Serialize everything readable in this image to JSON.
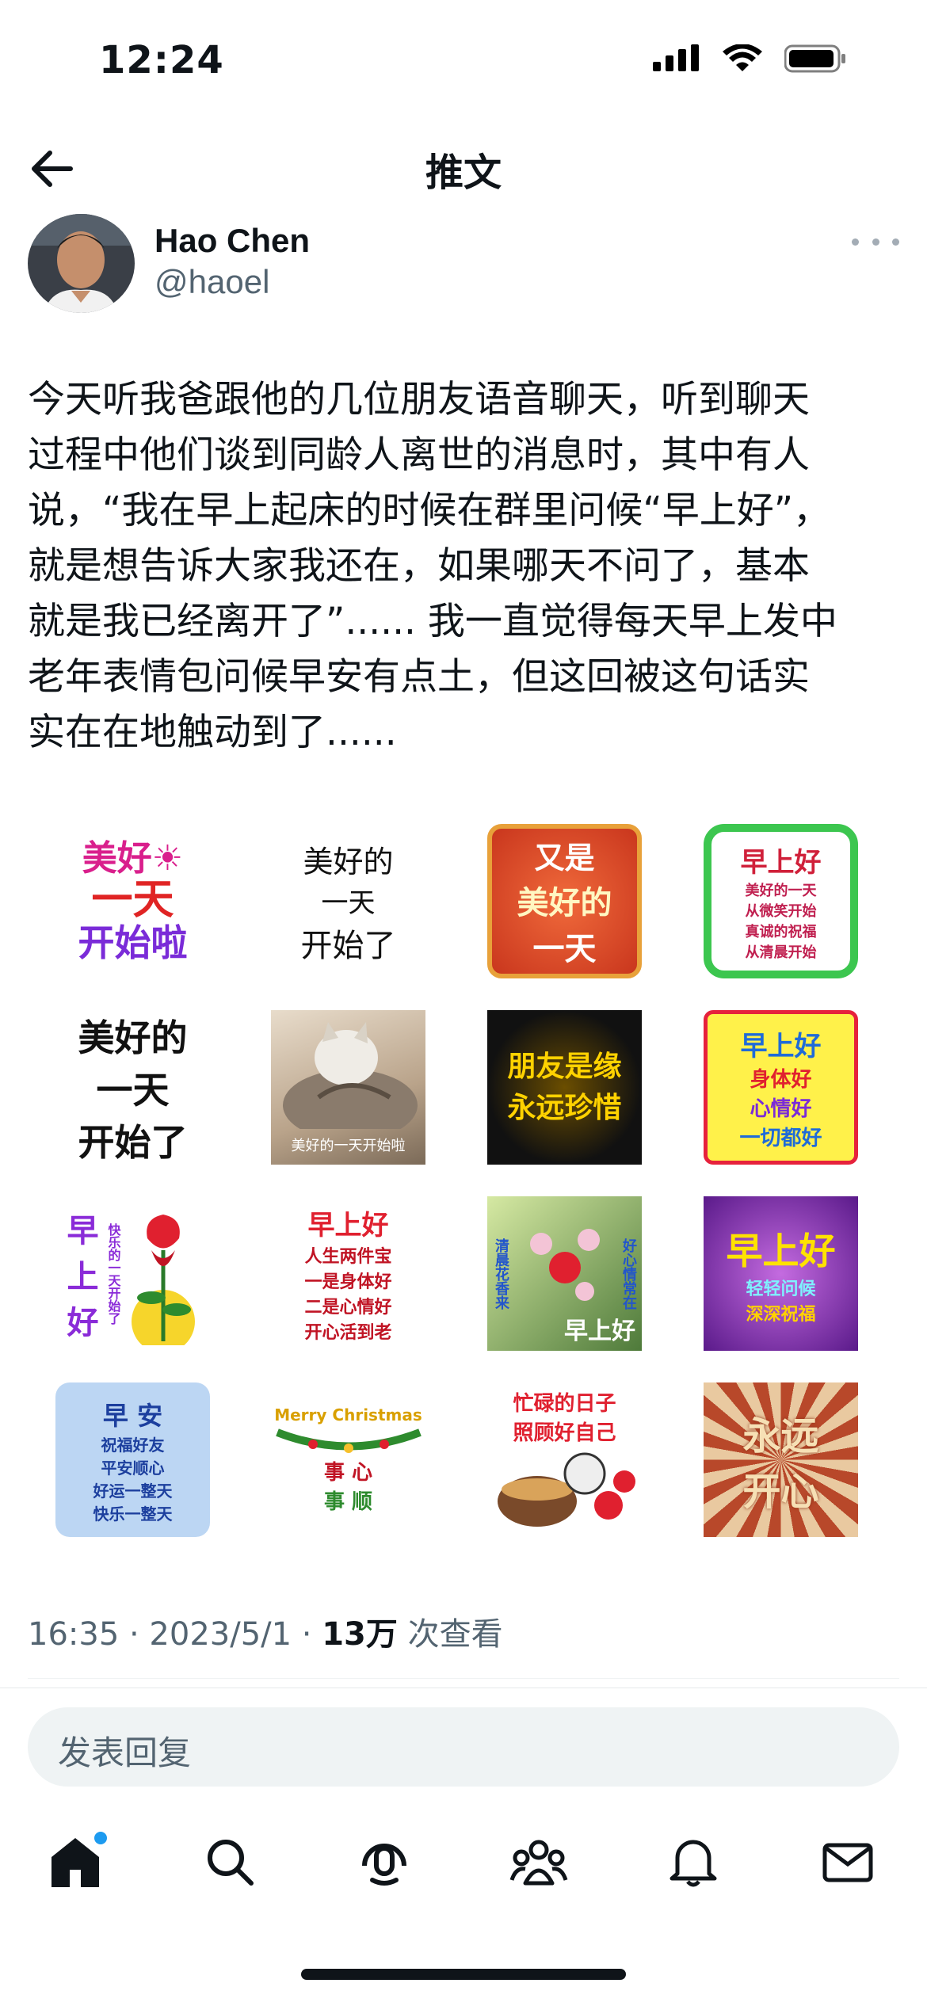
{
  "status_bar": {
    "time": "12:24"
  },
  "header": {
    "title": "推文"
  },
  "author": {
    "name": "Hao Chen",
    "handle": "@haoel"
  },
  "tweet": {
    "lines": [
      "今天听我爸跟他的几位朋友语音聊天，听到聊天",
      "过程中他们谈到同龄人离世的消息时，其中有人",
      "说，“我在早上起床的时候在群里问候“早上好”，",
      "就是想告诉大家我还在，如果哪天不问了，基本",
      "就是我已经离开了”...... 我一直觉得每天早上发中",
      "老年表情包问候早安有点土，但这回被这句话实",
      "实在在地触动到了......"
    ],
    "timestamp": "16:35 · 2023/5/1 · ",
    "views_count": "13万",
    "views_label": " 次查看"
  },
  "stickers": [
    {
      "lines": [
        "美好☀",
        "一天",
        "开始啦"
      ],
      "caption": ""
    },
    {
      "lines": [
        "美好的",
        "一天",
        "开始了"
      ],
      "caption": ""
    },
    {
      "lines": [
        "又是",
        "美好的",
        "一天"
      ],
      "caption": ""
    },
    {
      "lines": [
        "早上好",
        "美好的一天",
        "从微笑开始",
        "真诚的祝福",
        "从清晨开始"
      ],
      "caption": ""
    },
    {
      "lines": [
        "美好的",
        "一天",
        "开始了"
      ],
      "caption": ""
    },
    {
      "lines": [],
      "caption": "美好的一天开始啦"
    },
    {
      "lines": [
        "朋友是缘",
        "永远珍惜"
      ],
      "caption": ""
    },
    {
      "lines": [
        "早上好",
        "身体好",
        "心情好",
        "一切都好"
      ],
      "caption": ""
    },
    {
      "lines": [
        "早",
        "上",
        "好"
      ],
      "caption": "快乐的一天开始了"
    },
    {
      "lines": [
        "早上好",
        "人生两件宝",
        "一是身体好",
        "二是心情好",
        "开心活到老"
      ],
      "caption": ""
    },
    {
      "lines": [
        "清晨花香来",
        "好心情常在"
      ],
      "caption": "早上好"
    },
    {
      "lines": [
        "早上好",
        "轻轻问候",
        "深深祝福"
      ],
      "caption": ""
    },
    {
      "lines": [
        "早 安",
        "祝福好友",
        "平安顺心",
        "好运一整天",
        "快乐一整天"
      ],
      "caption": ""
    },
    {
      "lines": [
        "Merry Christmas",
        "事 心",
        "事 顺"
      ],
      "caption": ""
    },
    {
      "lines": [
        "忙碌的日子",
        "照顾好自己"
      ],
      "caption": ""
    },
    {
      "lines": [
        "永远",
        "开心"
      ],
      "caption": ""
    }
  ],
  "reply": {
    "placeholder": "发表回复"
  },
  "nav": {
    "items": [
      "home-icon",
      "search-icon",
      "spaces-icon",
      "communities-icon",
      "notifications-icon",
      "messages-icon"
    ]
  },
  "colors": {
    "accent": "#1d9bf0",
    "text": "#0f1419",
    "secondary": "#536471"
  }
}
